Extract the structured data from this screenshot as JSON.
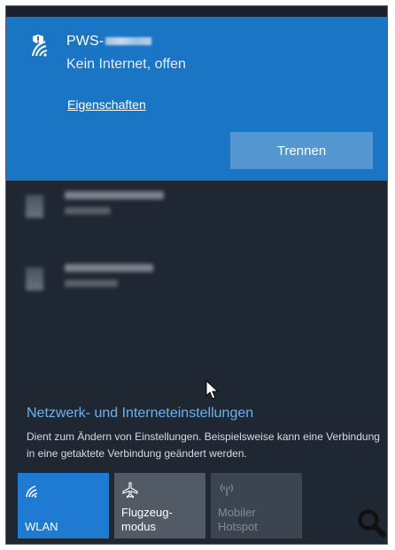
{
  "connected_network": {
    "name_prefix": "PWS-",
    "status": "Kein Internet, offen",
    "properties_link": "Eigenschaften",
    "disconnect_button": "Trennen"
  },
  "other_networks_count_shown": 2,
  "settings": {
    "title": "Netzwerk- und Interneteinstellungen",
    "description": "Dient zum Ändern von Einstellungen. Beispielsweise kann eine Verbindung in eine getaktete Verbindung geändert werden."
  },
  "quick_actions": [
    {
      "label": "WLAN",
      "icon": "wifi-icon",
      "state": "on"
    },
    {
      "label": "Flugzeug-\nmodus",
      "icon": "airplane-icon",
      "state": "off"
    },
    {
      "label": "Mobiler\nHotspot",
      "icon": "hotspot-icon",
      "state": "disabled"
    }
  ],
  "colors": {
    "accent": "#1a75c4",
    "flyout_bg": "#1f2733",
    "link": "#6bb2f0",
    "wlan_tile": "#1f7bd1"
  },
  "overlay_icon": "magnifier-icon"
}
